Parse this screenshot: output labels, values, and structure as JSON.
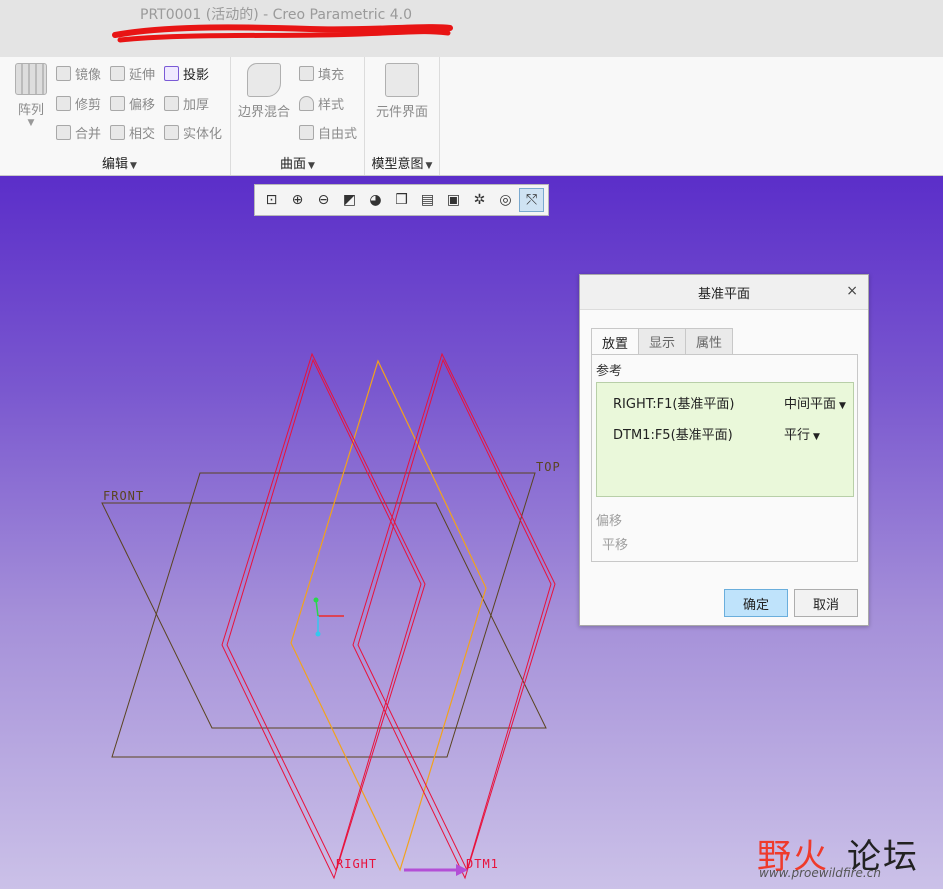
{
  "window": {
    "title": "PRT0001 (活动的) - Creo Parametric 4.0"
  },
  "ribbon": {
    "edit_group": {
      "label": "编辑",
      "pattern": "阵列",
      "mirror": "镜像",
      "extend": "延伸",
      "project": "投影",
      "trim": "修剪",
      "offset": "偏移",
      "thicken": "加厚",
      "merge": "合并",
      "intersect": "相交",
      "solidify": "实体化"
    },
    "surface_group": {
      "label": "曲面",
      "boundary_blend": "边界混合",
      "fill": "填充",
      "style": "样式",
      "freestyle": "自由式"
    },
    "model_intent_group": {
      "label": "模型意图",
      "component_interface": "元件界面"
    }
  },
  "view_toolbar": {
    "icons": [
      "refit-icon",
      "zoom-in-icon",
      "zoom-out-icon",
      "repaint-icon",
      "display-style-icon",
      "saved-orientations-icon",
      "view-manager-icon",
      "perspective-icon",
      "datum-display-icon",
      "spin-center-icon",
      "annotation-display-icon"
    ]
  },
  "model": {
    "labels": {
      "front": "FRONT",
      "top": "TOP",
      "right": "RIGHT",
      "dtm1": "DTM1"
    },
    "colors": {
      "frame": "#5a4420",
      "right_plane": "#e8123c",
      "dtm_plane": "#f2a21c",
      "arrow": "#b34fd6"
    }
  },
  "dialog": {
    "title": "基准平面",
    "close": "×",
    "tabs": [
      {
        "label": "放置",
        "selected": true
      },
      {
        "label": "显示",
        "selected": false
      },
      {
        "label": "属性",
        "selected": false
      }
    ],
    "references_label": "参考",
    "references": [
      {
        "name": "RIGHT:F1(基准平面)",
        "constraint": "中间平面"
      },
      {
        "name": "DTM1:F5(基准平面)",
        "constraint": "平行"
      }
    ],
    "offset_label": "偏移",
    "offset_value": "平移",
    "ok_label": "确定",
    "cancel_label": "取消"
  },
  "watermark": {
    "text_red": "野火",
    "text_dark": "论坛",
    "url": "www.proewildfire.cn"
  }
}
